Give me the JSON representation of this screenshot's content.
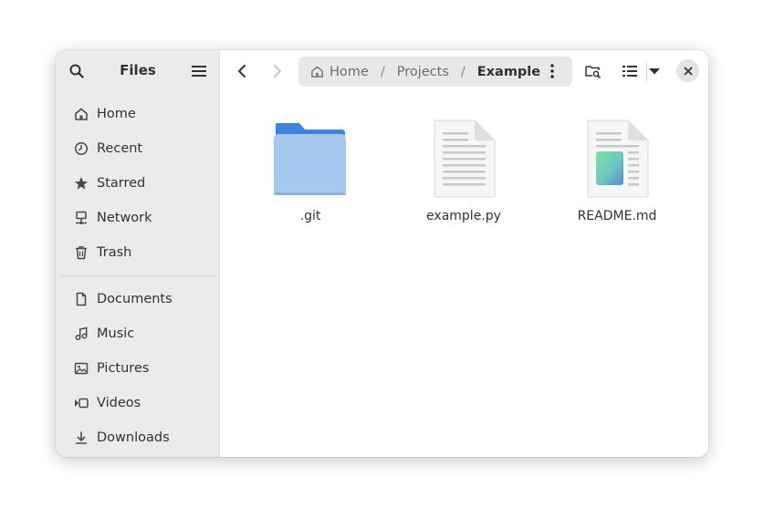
{
  "sidebar": {
    "title": "Files",
    "places": [
      {
        "label": "Home",
        "icon": "home-icon"
      },
      {
        "label": "Recent",
        "icon": "clock-icon"
      },
      {
        "label": "Starred",
        "icon": "star-icon"
      },
      {
        "label": "Network",
        "icon": "network-icon"
      },
      {
        "label": "Trash",
        "icon": "trash-icon"
      }
    ],
    "bookmarks": [
      {
        "label": "Documents",
        "icon": "document-icon"
      },
      {
        "label": "Music",
        "icon": "music-icon"
      },
      {
        "label": "Pictures",
        "icon": "picture-icon"
      },
      {
        "label": "Videos",
        "icon": "video-icon"
      },
      {
        "label": "Downloads",
        "icon": "download-icon"
      }
    ]
  },
  "pathbar": {
    "crumbs": [
      "Home",
      "Projects",
      "Example"
    ]
  },
  "files": [
    {
      "name": ".git",
      "type": "folder"
    },
    {
      "name": "example.py",
      "type": "text-file"
    },
    {
      "name": "README.md",
      "type": "markdown-file"
    }
  ],
  "colors": {
    "folder_back": "#3d84e0",
    "folder_front": "#a7c8ee",
    "sidebar_bg": "#ebebeb",
    "pathbar_bg": "#e8e8e8"
  }
}
